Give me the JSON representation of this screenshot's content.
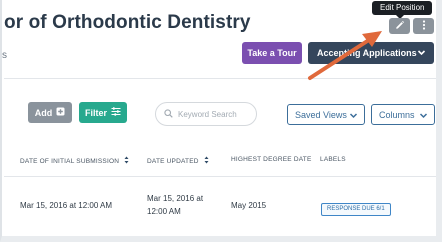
{
  "header": {
    "title": "or of Orthodontic Dentistry",
    "subtitle_fragment": "s",
    "tooltip": "Edit Position",
    "edit_icon": "pencil-icon",
    "more_icon": "vertical-dots-icon",
    "tour_button": "Take a Tour",
    "accept_button": "Accepting Applications"
  },
  "toolbar": {
    "add_label": "Add",
    "filter_label": "Filter",
    "search_placeholder": "Keyword Search",
    "saved_views_label": "Saved Views",
    "columns_label": "Columns"
  },
  "table": {
    "columns": [
      "Date of Initial Submission",
      "Date Updated",
      "Highest Degree Date",
      "Labels"
    ],
    "row": {
      "initial_submission": "Mar 15, 2016 at 12:00 AM",
      "updated_line1": "Mar 15, 2016 at",
      "updated_line2": "12:00 AM",
      "degree_date": "May 2015",
      "label_badge": "RESPONSE DUE 6/1"
    }
  },
  "colors": {
    "tour": "#7b4fb0",
    "accept": "#35465c",
    "filter": "#27a98e",
    "annotation_arrow": "#e0693b"
  }
}
